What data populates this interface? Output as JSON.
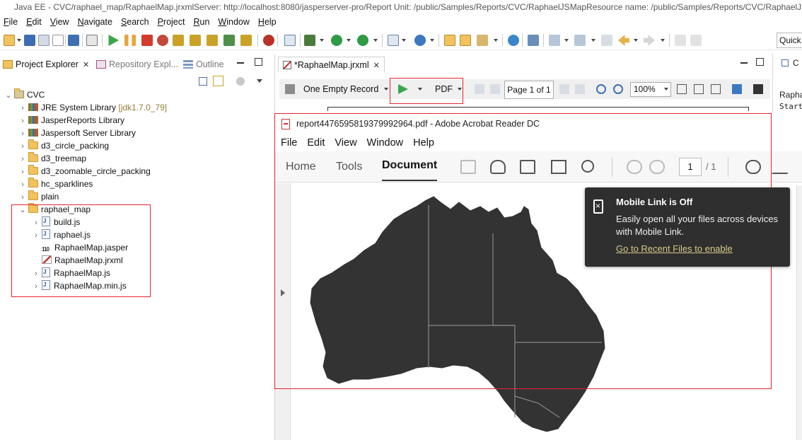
{
  "window": {
    "title": "Java EE - CVC/raphael_map/RaphaelMap.jrxmlServer: http://localhost:8080/jasperserver-pro/Report Unit: /public/Samples/Reports/CVC/RaphaelJSMapResource name: /public/Samples/Reports/CVC/RaphaelJSM"
  },
  "menubar": [
    "File",
    "Edit",
    "View",
    "Navigate",
    "Search",
    "Project",
    "Run",
    "Window",
    "Help"
  ],
  "toolbar": {
    "quick_access": "Quick"
  },
  "views": {
    "project_explorer": "Project Explorer",
    "repository_explorer": "Repository Expl...",
    "outline": "Outline"
  },
  "tree": {
    "root": "CVC",
    "items": [
      {
        "label": "JRE System Library",
        "suffix": "[jdk1.7.0_79]"
      },
      {
        "label": "JasperReports Library"
      },
      {
        "label": "Jaspersoft Server Library"
      },
      {
        "label": "d3_circle_packing"
      },
      {
        "label": "d3_treemap"
      },
      {
        "label": "d3_zoomable_circle_packing"
      },
      {
        "label": "hc_sparklines"
      },
      {
        "label": "plain"
      },
      {
        "label": "raphael_map"
      },
      {
        "label": "build.js"
      },
      {
        "label": "raphael.js"
      },
      {
        "label": "RaphaelMap.jasper"
      },
      {
        "label": "RaphaelMap.jrxml"
      },
      {
        "label": "RaphaelMap.js"
      },
      {
        "label": "RaphaelMap.min.js"
      }
    ]
  },
  "editor": {
    "tab": "*RaphaelMap.jrxml",
    "data_adapter": "One Empty Record",
    "output_format": "PDF",
    "page_info": "Page 1 of 1",
    "zoom": "100%"
  },
  "right_panel": {
    "tab": "C",
    "line1": "Rapha",
    "line2": "Start"
  },
  "acrobat": {
    "title": "report4476595819379992964.pdf - Adobe Acrobat Reader DC",
    "menu": [
      "File",
      "Edit",
      "View",
      "Window",
      "Help"
    ],
    "tabs": [
      "Home",
      "Tools",
      "Document"
    ],
    "active_tab": "Document",
    "page_current": "1",
    "page_total": "/ 1"
  },
  "toast": {
    "title": "Mobile Link is Off",
    "body": "Easily open all your files across devices with Mobile Link.",
    "link": "Go to Recent Files to enable"
  },
  "colors": {
    "highlight": "#e8242c",
    "map_fill": "#333333",
    "map_border": "#888888",
    "toast_bg": "#2f2f2f"
  }
}
